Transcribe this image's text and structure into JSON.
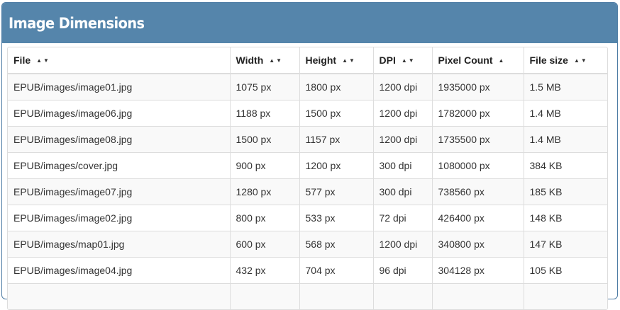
{
  "panel": {
    "title": "Image Dimensions"
  },
  "table": {
    "headers": [
      {
        "label": "File",
        "arrows": "▲▼"
      },
      {
        "label": "Width",
        "arrows": "▲▼"
      },
      {
        "label": "Height",
        "arrows": "▲▼"
      },
      {
        "label": "DPI",
        "arrows": "▲▼"
      },
      {
        "label": "Pixel Count",
        "arrows": "▲"
      },
      {
        "label": "File size",
        "arrows": "▲▼"
      }
    ],
    "rows": [
      [
        "EPUB/images/image01.jpg",
        "1075 px",
        "1800 px",
        "1200 dpi",
        "1935000 px",
        "1.5 MB"
      ],
      [
        "EPUB/images/image06.jpg",
        "1188 px",
        "1500 px",
        "1200 dpi",
        "1782000 px",
        "1.4 MB"
      ],
      [
        "EPUB/images/image08.jpg",
        "1500 px",
        "1157 px",
        "1200 dpi",
        "1735500 px",
        "1.4 MB"
      ],
      [
        "EPUB/images/cover.jpg",
        "900 px",
        "1200 px",
        "300 dpi",
        "1080000 px",
        "384 KB"
      ],
      [
        "EPUB/images/image07.jpg",
        "1280 px",
        "577 px",
        "300 dpi",
        "738560 px",
        "185 KB"
      ],
      [
        "EPUB/images/image02.jpg",
        "800 px",
        "533 px",
        "72 dpi",
        "426400 px",
        "148 KB"
      ],
      [
        "EPUB/images/map01.jpg",
        "600 px",
        "568 px",
        "1200 dpi",
        "340800 px",
        "147 KB"
      ],
      [
        "EPUB/images/image04.jpg",
        "432 px",
        "704 px",
        "96 dpi",
        "304128 px",
        "105 KB"
      ],
      [
        "",
        "",
        "",
        "",
        "",
        ""
      ]
    ]
  },
  "colors": {
    "heading_bg": "#5585ab",
    "heading_text": "#ffffff",
    "stripe": "#f9f9f9",
    "border": "#dddddd"
  }
}
